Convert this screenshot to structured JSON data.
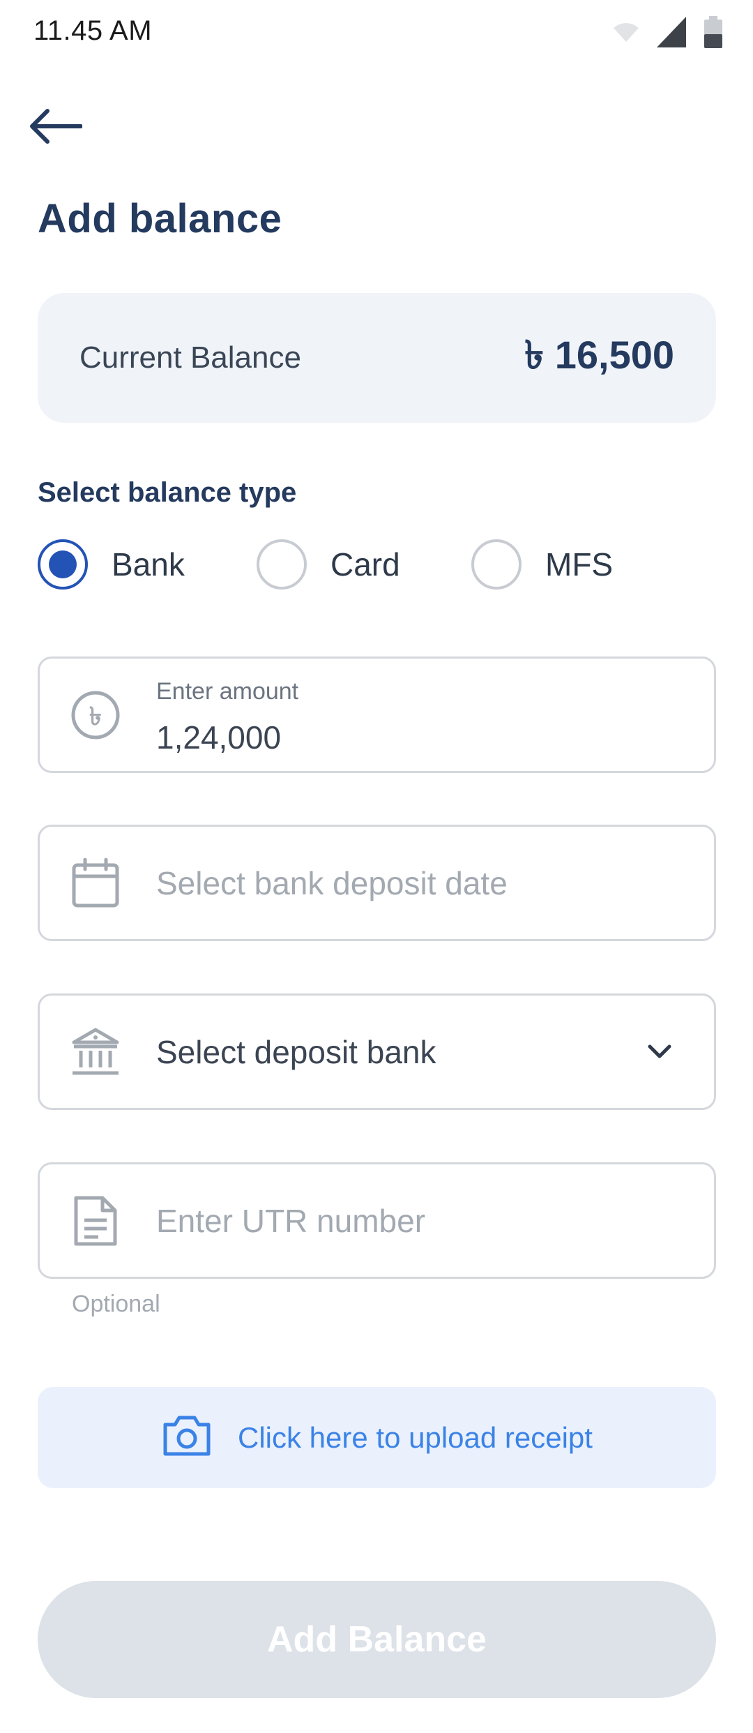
{
  "status_bar": {
    "time": "11.45 AM",
    "icons": [
      "wifi-icon",
      "signal-icon",
      "battery-icon"
    ]
  },
  "header": {
    "back_icon": "arrow-left-icon",
    "title": "Add balance"
  },
  "balance_card": {
    "label": "Current Balance",
    "value": "৳ 16,500"
  },
  "balance_type": {
    "label": "Select balance type",
    "options": [
      {
        "label": "Bank",
        "selected": true
      },
      {
        "label": "Card",
        "selected": false
      },
      {
        "label": "MFS",
        "selected": false
      }
    ]
  },
  "amount_field": {
    "icon": "taka-coin-icon",
    "label": "Enter amount",
    "value": "1,24,000"
  },
  "date_field": {
    "icon": "calendar-icon",
    "placeholder": "Select bank deposit date"
  },
  "bank_field": {
    "icon": "bank-icon",
    "value": "Select deposit bank",
    "dropdown_icon": "chevron-down-icon"
  },
  "utr_field": {
    "icon": "document-icon",
    "placeholder": "Enter UTR number",
    "helper": "Optional"
  },
  "upload": {
    "icon": "camera-icon",
    "label": "Click here to upload receipt"
  },
  "submit": {
    "label": "Add Balance",
    "enabled": false
  },
  "colors": {
    "primary": "#2453b6",
    "title": "#243a5e",
    "link": "#3b82e6",
    "upload_bg": "#eaf1fd",
    "card_bg": "#f0f4f9",
    "disabled_button": "#dde1e8"
  }
}
